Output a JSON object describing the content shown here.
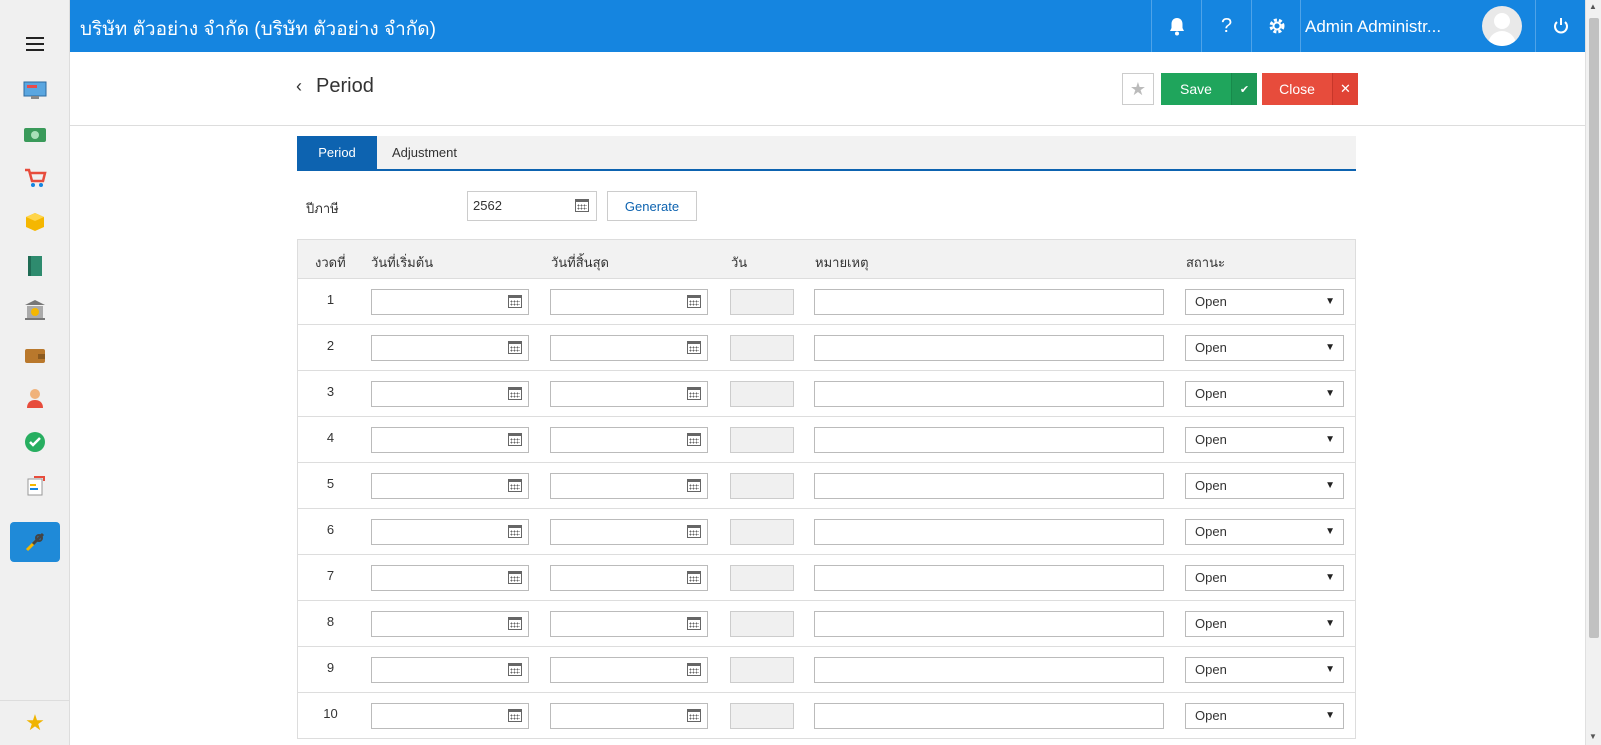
{
  "app": {
    "company": "บริษัท ตัวอย่าง จำกัด (บริษัท ตัวอย่าง จำกัด)",
    "user_name": "Admin Administr...",
    "help_label": "?"
  },
  "header": {
    "title": "Period",
    "save_label": "Save",
    "close_label": "Close"
  },
  "tabs": [
    {
      "label": "Period",
      "active": true
    },
    {
      "label": "Adjustment",
      "active": false
    }
  ],
  "fiscal_year": {
    "label": "ปีภาษี",
    "value": "2562",
    "generate_label": "Generate"
  },
  "table": {
    "headers": [
      "งวดที่",
      "วันที่เริ่มต้น",
      "วันที่สิ้นสุด",
      "วัน",
      "หมายเหตุ",
      "สถานะ"
    ],
    "rows": [
      {
        "num": "1",
        "status": "Open"
      },
      {
        "num": "2",
        "status": "Open"
      },
      {
        "num": "3",
        "status": "Open"
      },
      {
        "num": "4",
        "status": "Open"
      },
      {
        "num": "5",
        "status": "Open"
      },
      {
        "num": "6",
        "status": "Open"
      },
      {
        "num": "7",
        "status": "Open"
      },
      {
        "num": "8",
        "status": "Open"
      },
      {
        "num": "9",
        "status": "Open"
      },
      {
        "num": "10",
        "status": "Open"
      }
    ]
  },
  "sidebar_icons": [
    "dashboard-icon",
    "money-icon",
    "cart-icon",
    "box-icon",
    "book-icon",
    "bank-icon",
    "wallet-icon",
    "user-icon",
    "check-icon",
    "report-icon",
    "tools-icon"
  ],
  "colors": {
    "topbar": "#1585e0",
    "tab_active": "#0d63b0",
    "save": "#1fa55c",
    "close": "#e74c3c"
  }
}
